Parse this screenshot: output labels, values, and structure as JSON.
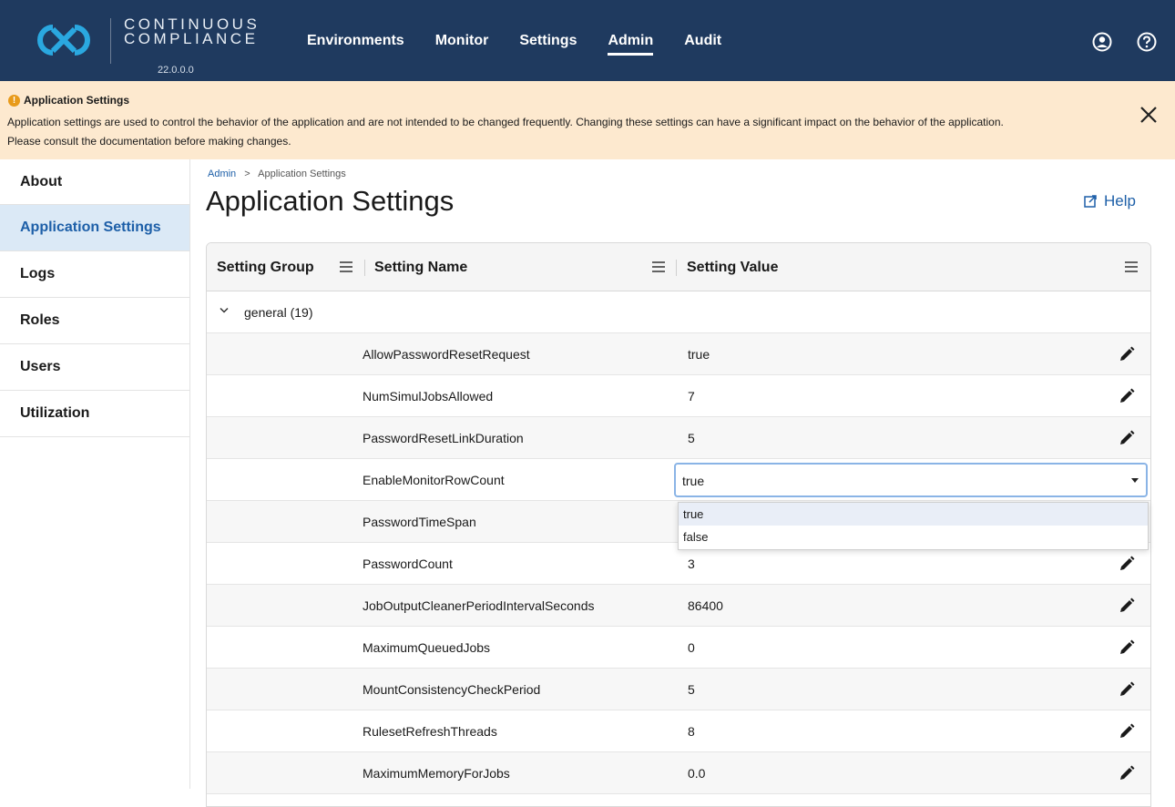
{
  "header": {
    "brand_line1": "CONTINUOUS",
    "brand_line2": "COMPLIANCE",
    "version": "22.0.0.0",
    "nav": [
      {
        "label": "Environments",
        "active": false
      },
      {
        "label": "Monitor",
        "active": false
      },
      {
        "label": "Settings",
        "active": false
      },
      {
        "label": "Admin",
        "active": true
      },
      {
        "label": "Audit",
        "active": false
      }
    ],
    "icons": [
      "account-circle-icon",
      "help-circle-icon"
    ],
    "bg_color": "#1f3a5f"
  },
  "banner": {
    "title": "Application Settings",
    "line1": "Application settings are used to control the behavior of the application and are not intended to be changed frequently. Changing these settings can have a significant impact on the behavior of the application.",
    "line2": "Please consult the documentation before making changes.",
    "bg_color": "#fde9cf"
  },
  "sidebar": {
    "items": [
      {
        "label": "About",
        "active": false
      },
      {
        "label": "Application Settings",
        "active": true
      },
      {
        "label": "Logs",
        "active": false
      },
      {
        "label": "Roles",
        "active": false
      },
      {
        "label": "Users",
        "active": false
      },
      {
        "label": "Utilization",
        "active": false
      }
    ]
  },
  "breadcrumb": {
    "parent": "Admin",
    "separator": ">",
    "current": "Application Settings"
  },
  "page": {
    "title": "Application Settings",
    "help_label": "Help"
  },
  "grid": {
    "columns": [
      "Setting Group",
      "Setting Name",
      "Setting Value"
    ],
    "group": {
      "label": "general (19)",
      "expanded": true
    },
    "rows": [
      {
        "name": "AllowPasswordResetRequest",
        "value": "true"
      },
      {
        "name": "NumSimulJobsAllowed",
        "value": "7"
      },
      {
        "name": "PasswordResetLinkDuration",
        "value": "5"
      },
      {
        "name": "EnableMonitorRowCount",
        "value": "true",
        "editing": true
      },
      {
        "name": "PasswordTimeSpan",
        "value": ""
      },
      {
        "name": "PasswordCount",
        "value": "3"
      },
      {
        "name": "JobOutputCleanerPeriodIntervalSeconds",
        "value": "86400"
      },
      {
        "name": "MaximumQueuedJobs",
        "value": "0"
      },
      {
        "name": "MountConsistencyCheckPeriod",
        "value": "5"
      },
      {
        "name": "RulesetRefreshThreads",
        "value": "8"
      },
      {
        "name": "MaximumMemoryForJobs",
        "value": "0.0"
      }
    ]
  },
  "dropdown": {
    "options": [
      "true",
      "false"
    ],
    "highlighted": "true"
  }
}
